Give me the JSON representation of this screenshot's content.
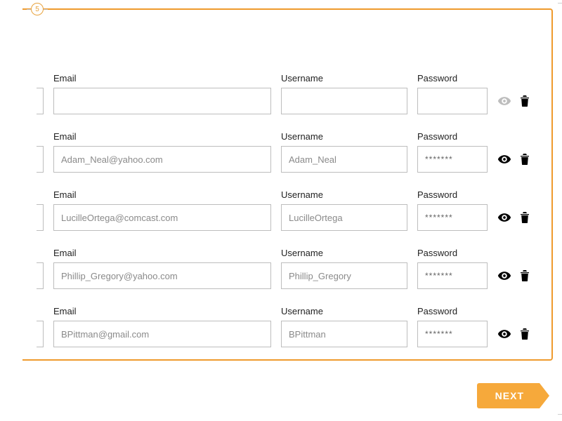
{
  "step": "5",
  "labels": {
    "email": "Email",
    "username": "Username",
    "password": "Password"
  },
  "rows": [
    {
      "email": "",
      "username": "",
      "password": "",
      "eye_style": "muted"
    },
    {
      "email": "Adam_Neal@yahoo.com",
      "username": "Adam_Neal",
      "password": "*******",
      "eye_style": "solid"
    },
    {
      "email": "LucilleOrtega@comcast.com",
      "username": "LucilleOrtega",
      "password": "*******",
      "eye_style": "solid"
    },
    {
      "email": "Phillip_Gregory@yahoo.com",
      "username": "Phillip_Gregory",
      "password": "*******",
      "eye_style": "solid"
    },
    {
      "email": "BPittman@gmail.com",
      "username": "BPittman",
      "password": "*******",
      "eye_style": "solid"
    }
  ],
  "buttons": {
    "next": "NEXT"
  }
}
